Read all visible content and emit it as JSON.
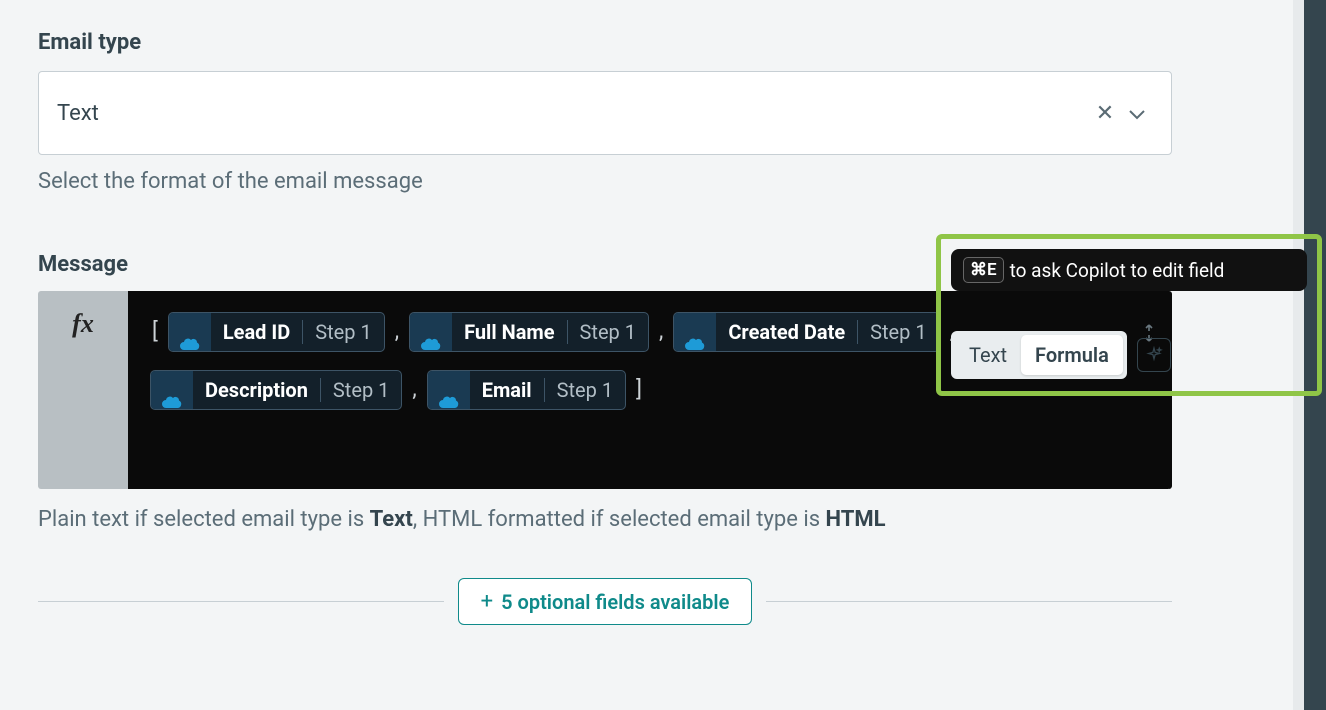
{
  "emailType": {
    "label": "Email type",
    "value": "Text",
    "help": "Select the format of the email message"
  },
  "message": {
    "label": "Message",
    "segments": {
      "text": "Text",
      "formula": "Formula"
    },
    "tooltip": {
      "shortcut": "⌘E",
      "text": "to ask Copilot to edit field"
    },
    "gutter_icon": "fx",
    "brackets": {
      "open": "[",
      "close": "]"
    },
    "comma": ",",
    "pills": [
      {
        "name": "Lead ID",
        "step": "Step 1"
      },
      {
        "name": "Full Name",
        "step": "Step 1"
      },
      {
        "name": "Created Date",
        "step": "Step 1"
      },
      {
        "name": "Description",
        "step": "Step 1"
      },
      {
        "name": "Email",
        "step": "Step 1"
      }
    ],
    "help_prefix": "Plain text if selected email type is ",
    "help_bold1": "Text",
    "help_mid": ", HTML formatted if selected email type is ",
    "help_bold2": "HTML"
  },
  "optional": {
    "label": "5 optional fields available"
  }
}
